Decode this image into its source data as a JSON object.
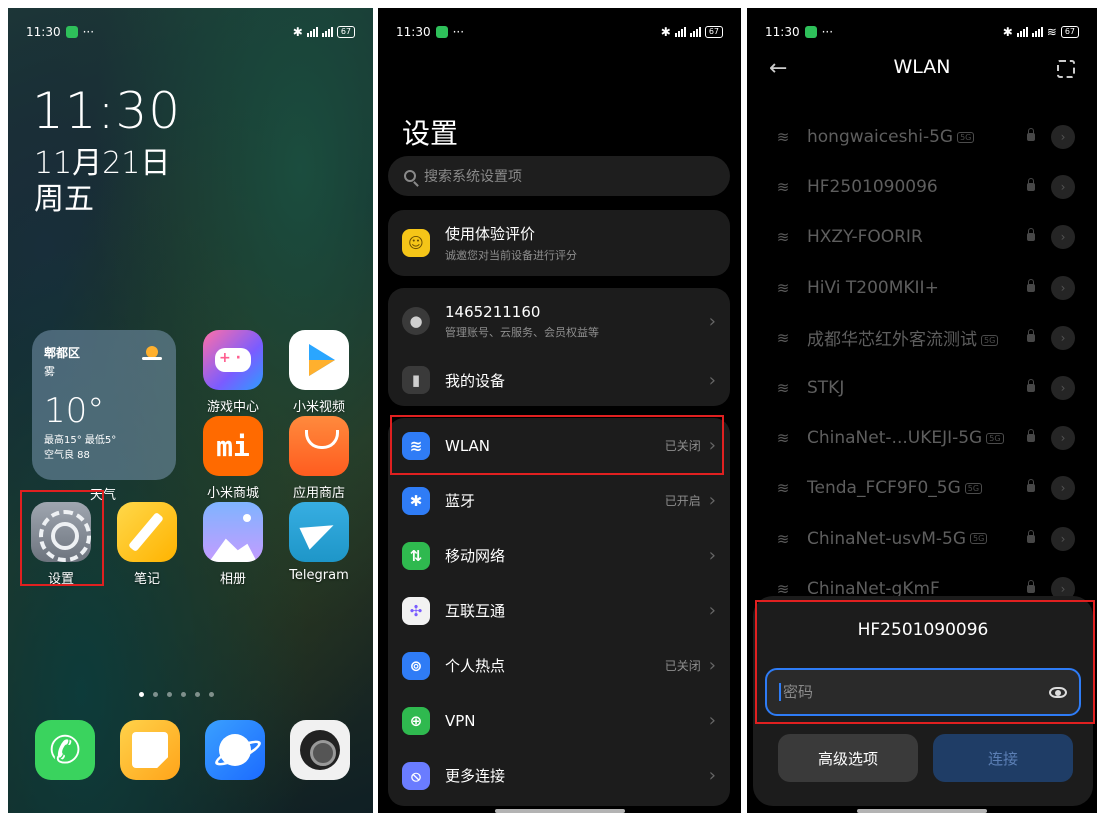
{
  "home": {
    "status": {
      "time": "11:30",
      "dots": "···",
      "right": "5GA  5G  67"
    },
    "clock": "11:30",
    "date": "11月21日",
    "weekday": "周五",
    "weather": {
      "location": "郫都区",
      "condition": "雾",
      "temperature": "10°",
      "range": "最高15° 最低5°",
      "aqi": "空气良 88",
      "label": "天气"
    },
    "apps": [
      {
        "name": "游戏中心",
        "icon": "game-center-icon"
      },
      {
        "name": "小米视频",
        "icon": "mi-video-icon"
      },
      {
        "name": "小米商城",
        "icon": "mi-store-icon"
      },
      {
        "name": "应用商店",
        "icon": "app-store-icon"
      },
      {
        "name": "设置",
        "icon": "settings-icon"
      },
      {
        "name": "笔记",
        "icon": "notes-icon"
      },
      {
        "name": "相册",
        "icon": "gallery-icon"
      },
      {
        "name": "Telegram",
        "icon": "telegram-icon"
      }
    ],
    "mi_logo": "mi",
    "dock": [
      "phone-icon",
      "messages-icon",
      "browser-icon",
      "camera-icon"
    ]
  },
  "settings": {
    "status": {
      "time": "11:30",
      "dots": "···",
      "right": "5GA  5G  67"
    },
    "title": "设置",
    "search_placeholder": "搜索系统设置项",
    "feedback": {
      "title": "使用体验评价",
      "subtitle": "诚邀您对当前设备进行评分"
    },
    "account": {
      "id": "1465211160",
      "subtitle": "管理账号、云服务、会员权益等"
    },
    "my_device": "我的设备",
    "rows": [
      {
        "label": "WLAN",
        "value": "已关闭",
        "icon": "wifi-icon",
        "color": "#2f7cf6"
      },
      {
        "label": "蓝牙",
        "value": "已开启",
        "icon": "bluetooth-icon",
        "color": "#2f7cf6"
      },
      {
        "label": "移动网络",
        "value": "",
        "icon": "mobile-data-icon",
        "color": "#2fb94f"
      },
      {
        "label": "互联互通",
        "value": "",
        "icon": "interconnect-icon",
        "color": "#f2f2f2"
      },
      {
        "label": "个人热点",
        "value": "已关闭",
        "icon": "hotspot-icon",
        "color": "#2f7cf6"
      },
      {
        "label": "VPN",
        "value": "",
        "icon": "vpn-icon",
        "color": "#2fb94f"
      },
      {
        "label": "更多连接",
        "value": "",
        "icon": "more-connections-icon",
        "color": "#6a7cff"
      }
    ]
  },
  "wlan": {
    "status": {
      "time": "11:30",
      "dots": "···",
      "right": "5GA  5G  67"
    },
    "title": "WLAN",
    "networks": [
      {
        "ssid": "hongwaiceshi-5G",
        "tag": "5G"
      },
      {
        "ssid": "HF2501090096",
        "tag": ""
      },
      {
        "ssid": "HXZY-FOORIR",
        "tag": ""
      },
      {
        "ssid": "HiVi T200MKII+",
        "tag": ""
      },
      {
        "ssid": "成都华芯红外客流测试",
        "tag": "5G"
      },
      {
        "ssid": "STKJ",
        "tag": ""
      },
      {
        "ssid": "ChinaNet-...UKEJI-5G",
        "tag": "5G"
      },
      {
        "ssid": "Tenda_FCF9F0_5G",
        "tag": "5G"
      },
      {
        "ssid": "ChinaNet-usvM-5G",
        "tag": "5G"
      },
      {
        "ssid": "ChinaNet-gKmF",
        "tag": ""
      }
    ],
    "dialog": {
      "network": "HF2501090096",
      "password_placeholder": "密码",
      "advanced": "高级选项",
      "connect": "连接"
    }
  }
}
